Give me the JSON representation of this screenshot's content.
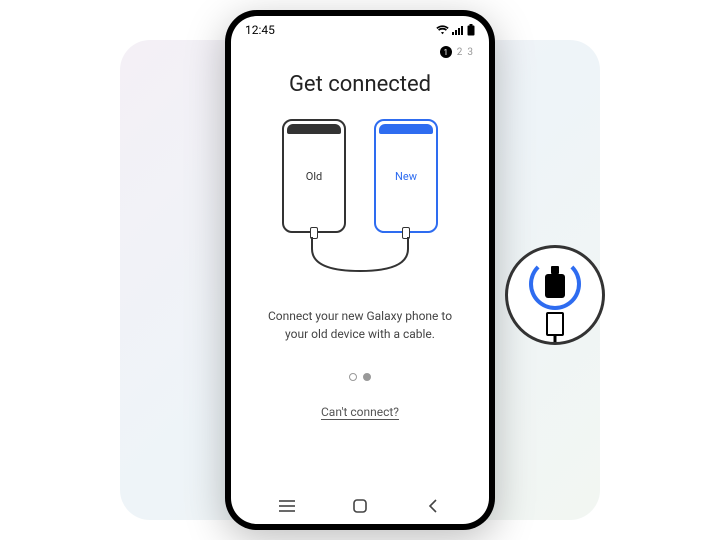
{
  "status_bar": {
    "time": "12:45"
  },
  "stepper": {
    "current": "1",
    "next1": "2",
    "next2": "3"
  },
  "heading": "Get connected",
  "diagram": {
    "old_label": "Old",
    "new_label": "New"
  },
  "instruction_line1": "Connect your new Galaxy phone to",
  "instruction_line2": "your old device with a cable.",
  "cant_connect": "Can't connect?"
}
